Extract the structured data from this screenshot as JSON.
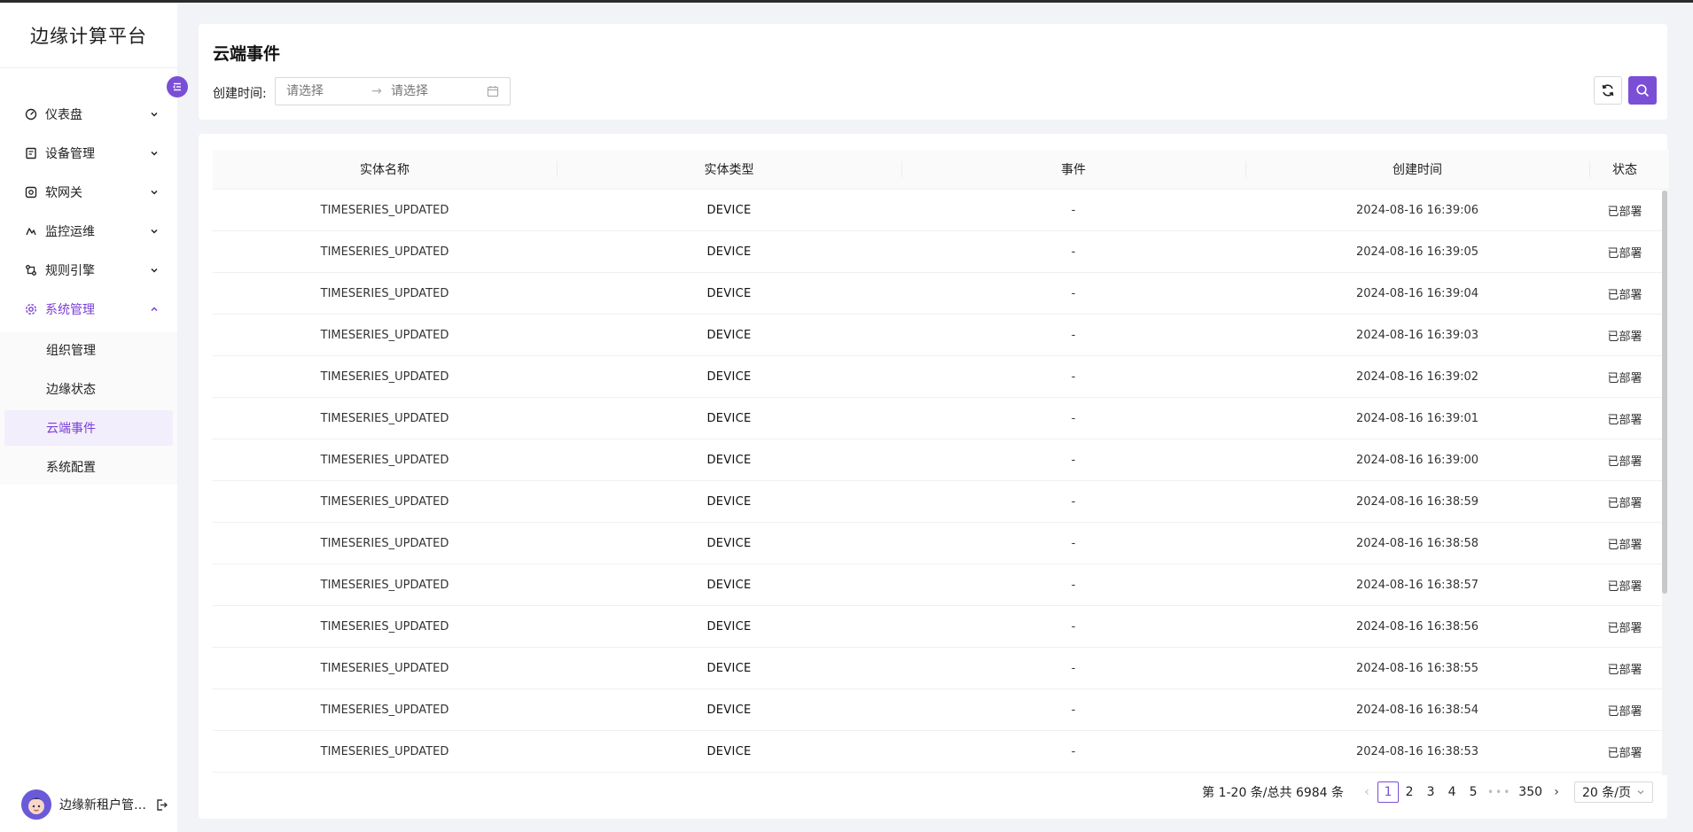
{
  "sidebar": {
    "logo": "边缘计算平台",
    "menu": [
      {
        "label": "仪表盘",
        "icon": "dashboard-icon"
      },
      {
        "label": "设备管理",
        "icon": "device-icon"
      },
      {
        "label": "软网关",
        "icon": "gateway-icon"
      },
      {
        "label": "监控运维",
        "icon": "monitor-icon"
      },
      {
        "label": "规则引擎",
        "icon": "rule-icon"
      },
      {
        "label": "系统管理",
        "icon": "gear-icon"
      }
    ],
    "submenu": [
      "组织管理",
      "边缘状态",
      "云端事件",
      "系统配置"
    ],
    "active_submenu": "云端事件",
    "user_name": "边缘新租户管…"
  },
  "header": {
    "title": "云端事件",
    "filter_label": "创建时间:",
    "start_placeholder": "请选择",
    "end_placeholder": "请选择",
    "range_arrow": "→"
  },
  "table": {
    "columns": [
      "实体名称",
      "实体类型",
      "事件",
      "创建时间",
      "状态"
    ],
    "rows": [
      [
        "TIMESERIES_UPDATED",
        "DEVICE",
        "-",
        "2024-08-16 16:39:06",
        "已部署"
      ],
      [
        "TIMESERIES_UPDATED",
        "DEVICE",
        "-",
        "2024-08-16 16:39:05",
        "已部署"
      ],
      [
        "TIMESERIES_UPDATED",
        "DEVICE",
        "-",
        "2024-08-16 16:39:04",
        "已部署"
      ],
      [
        "TIMESERIES_UPDATED",
        "DEVICE",
        "-",
        "2024-08-16 16:39:03",
        "已部署"
      ],
      [
        "TIMESERIES_UPDATED",
        "DEVICE",
        "-",
        "2024-08-16 16:39:02",
        "已部署"
      ],
      [
        "TIMESERIES_UPDATED",
        "DEVICE",
        "-",
        "2024-08-16 16:39:01",
        "已部署"
      ],
      [
        "TIMESERIES_UPDATED",
        "DEVICE",
        "-",
        "2024-08-16 16:39:00",
        "已部署"
      ],
      [
        "TIMESERIES_UPDATED",
        "DEVICE",
        "-",
        "2024-08-16 16:38:59",
        "已部署"
      ],
      [
        "TIMESERIES_UPDATED",
        "DEVICE",
        "-",
        "2024-08-16 16:38:58",
        "已部署"
      ],
      [
        "TIMESERIES_UPDATED",
        "DEVICE",
        "-",
        "2024-08-16 16:38:57",
        "已部署"
      ],
      [
        "TIMESERIES_UPDATED",
        "DEVICE",
        "-",
        "2024-08-16 16:38:56",
        "已部署"
      ],
      [
        "TIMESERIES_UPDATED",
        "DEVICE",
        "-",
        "2024-08-16 16:38:55",
        "已部署"
      ],
      [
        "TIMESERIES_UPDATED",
        "DEVICE",
        "-",
        "2024-08-16 16:38:54",
        "已部署"
      ],
      [
        "TIMESERIES_UPDATED",
        "DEVICE",
        "-",
        "2024-08-16 16:38:53",
        "已部署"
      ]
    ]
  },
  "pagination": {
    "total_text": "第 1-20 条/总共 6984 条",
    "prev": "‹",
    "next": "›",
    "pages": [
      "1",
      "2",
      "3",
      "4",
      "5"
    ],
    "current": "1",
    "ellipsis": "•••",
    "last_page": "350",
    "page_size": "20 条/页"
  },
  "colors": {
    "accent": "#7a4fd6",
    "active_text": "#7a3fd6",
    "active_bg": "#f3eefc"
  }
}
